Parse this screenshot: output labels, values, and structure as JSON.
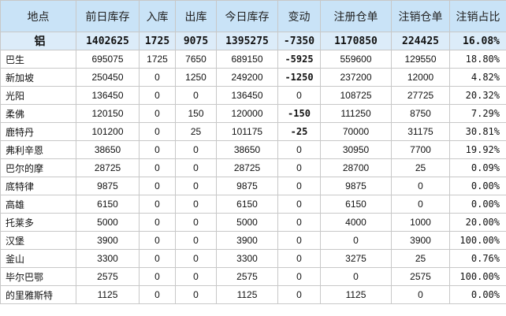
{
  "headers": [
    "地点",
    "前日库存",
    "入库",
    "出库",
    "今日库存",
    "变动",
    "注册仓单",
    "注销仓单",
    "注销占比"
  ],
  "summary": [
    "铝",
    "1402625",
    "1725",
    "9075",
    "1395275",
    "-7350",
    "1170850",
    "224425",
    "16.08%"
  ],
  "rows": [
    [
      "巴生",
      "695075",
      "1725",
      "7650",
      "689150",
      "-5925",
      "559600",
      "129550",
      "18.80%"
    ],
    [
      "新加坡",
      "250450",
      "0",
      "1250",
      "249200",
      "-1250",
      "237200",
      "12000",
      "4.82%"
    ],
    [
      "光阳",
      "136450",
      "0",
      "0",
      "136450",
      "0",
      "108725",
      "27725",
      "20.32%"
    ],
    [
      "柔佛",
      "120150",
      "0",
      "150",
      "120000",
      "-150",
      "111250",
      "8750",
      "7.29%"
    ],
    [
      "鹿特丹",
      "101200",
      "0",
      "25",
      "101175",
      "-25",
      "70000",
      "31175",
      "30.81%"
    ],
    [
      "弗利辛恩",
      "38650",
      "0",
      "0",
      "38650",
      "0",
      "30950",
      "7700",
      "19.92%"
    ],
    [
      "巴尔的摩",
      "28725",
      "0",
      "0",
      "28725",
      "0",
      "28700",
      "25",
      "0.09%"
    ],
    [
      "底特律",
      "9875",
      "0",
      "0",
      "9875",
      "0",
      "9875",
      "0",
      "0.00%"
    ],
    [
      "高雄",
      "6150",
      "0",
      "0",
      "6150",
      "0",
      "6150",
      "0",
      "0.00%"
    ],
    [
      "托莱多",
      "5000",
      "0",
      "0",
      "5000",
      "0",
      "4000",
      "1000",
      "20.00%"
    ],
    [
      "汉堡",
      "3900",
      "0",
      "0",
      "3900",
      "0",
      "0",
      "3900",
      "100.00%"
    ],
    [
      "釜山",
      "3300",
      "0",
      "0",
      "3300",
      "0",
      "3275",
      "25",
      "0.76%"
    ],
    [
      "毕尔巴鄂",
      "2575",
      "0",
      "0",
      "2575",
      "0",
      "0",
      "2575",
      "100.00%"
    ],
    [
      "的里雅斯特",
      "1125",
      "0",
      "0",
      "1125",
      "0",
      "1125",
      "0",
      "0.00%"
    ]
  ]
}
